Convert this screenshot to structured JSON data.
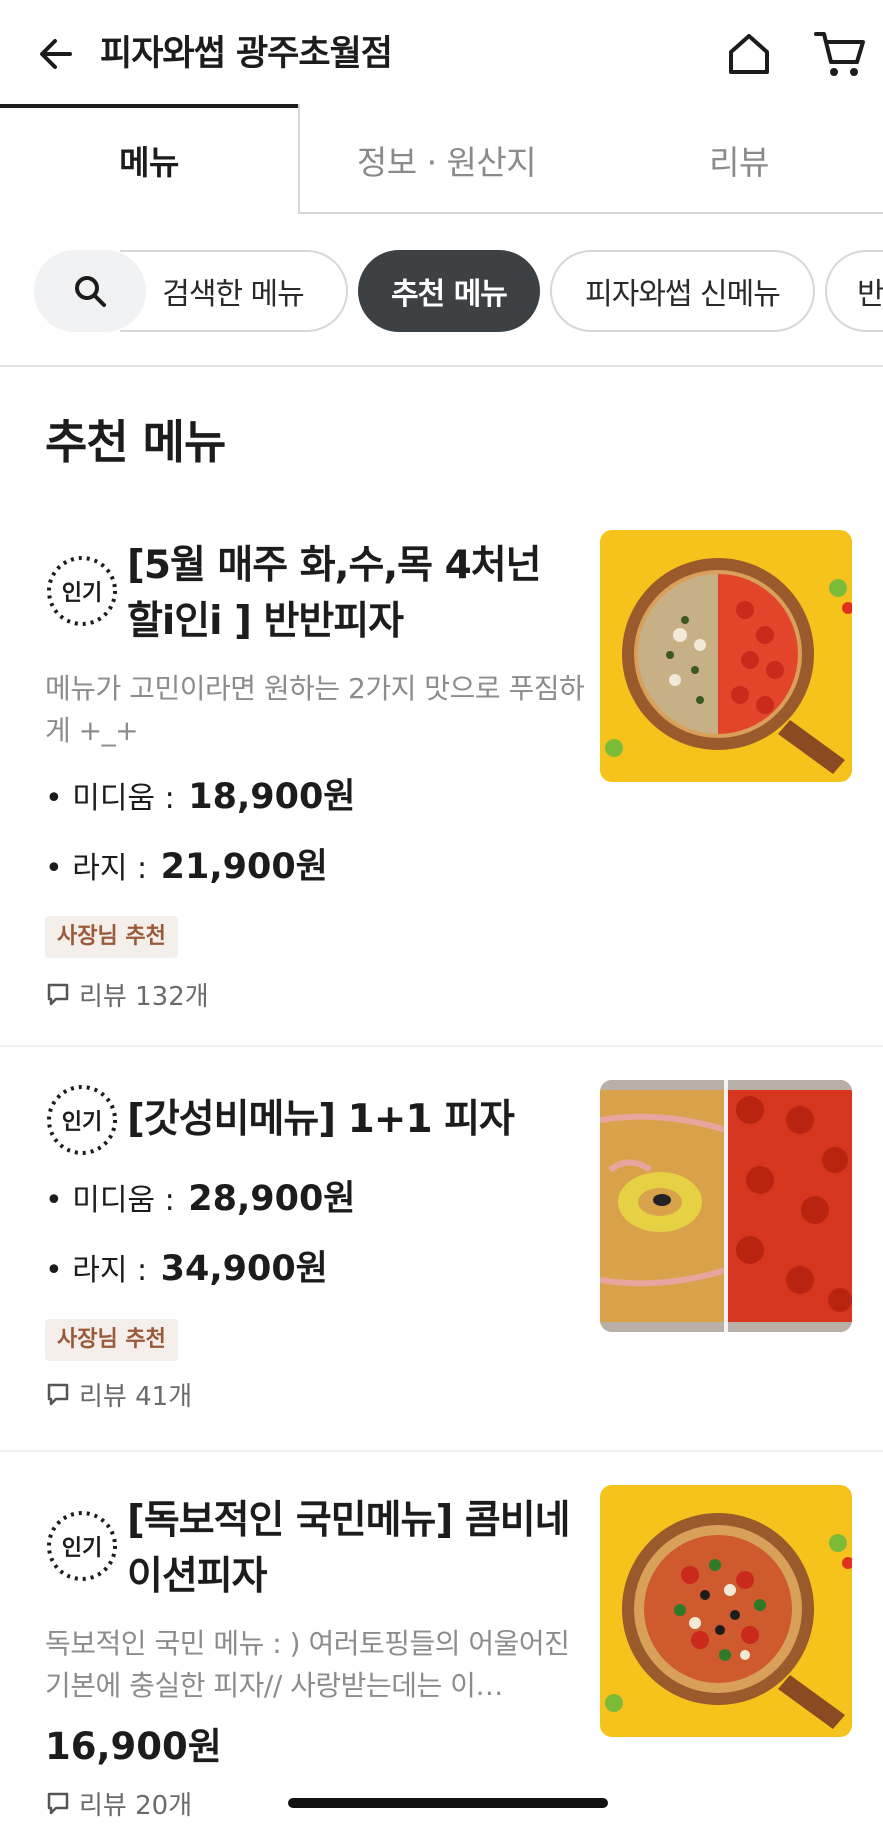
{
  "header": {
    "title": "피자와썹 광주초월점"
  },
  "tabs": [
    {
      "label": "메뉴"
    },
    {
      "label": "정보 · 원산지"
    },
    {
      "label": "리뷰"
    }
  ],
  "chips": [
    {
      "label": "검색한 메뉴"
    },
    {
      "label": "추천 메뉴"
    },
    {
      "label": "피자와썹 신메뉴"
    },
    {
      "label": "반"
    }
  ],
  "section": {
    "title": "추천 메뉴"
  },
  "popular_badge": "인기",
  "items": [
    {
      "name": "[5월 매주 화,수,목 4처넌 할i인i ] 반반피자",
      "description": "메뉴가 고민이라면 원하는 2가지 맛으로 푸짐하게 +_+",
      "prices": [
        {
          "label": "• 미디움 :",
          "value": "18,900원"
        },
        {
          "label": "• 라지 :",
          "value": "21,900원"
        }
      ],
      "tag": "사장님 추천",
      "review": "리뷰 132개"
    },
    {
      "name": "[갓성비메뉴] 1+1 피자",
      "prices": [
        {
          "label": "• 미디움 :",
          "value": "28,900원"
        },
        {
          "label": "• 라지 :",
          "value": "34,900원"
        }
      ],
      "tag": "사장님 추천",
      "review": "리뷰 41개"
    },
    {
      "name": "[독보적인 국민메뉴] 콤비네이션피자",
      "description": "독보적인 국민 메뉴 : ) 여러토핑들의 어울어진 기본에 충실한 피자// 사랑받는데는 이…",
      "price": "16,900원",
      "review": "리뷰 20개"
    }
  ],
  "colors": {
    "active_chip": "#3d4144",
    "tag_bg": "#f4efea",
    "tag_text": "#9a5a3a",
    "thumb_bg": "#f6c21c"
  }
}
